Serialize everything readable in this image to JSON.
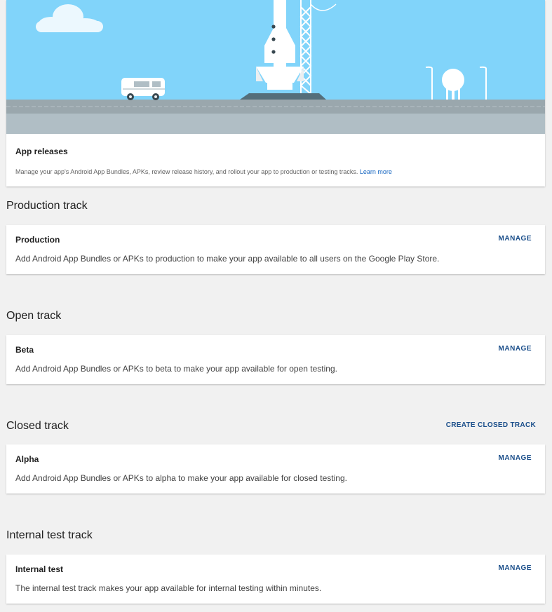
{
  "hero": {
    "title": "App releases",
    "description": "Manage your app's Android App Bundles, APKs, review release history, and rollout your app to production or testing tracks.",
    "link": "Learn more",
    "colors": {
      "sky": "#81d4fa",
      "ground": "#b0bec5"
    }
  },
  "sections": [
    {
      "title": "Production track",
      "action": "",
      "card": {
        "name": "Production",
        "description": "Add Android App Bundles or APKs to production to make your app available to all users on the Google Play Store.",
        "button": "MANAGE"
      }
    },
    {
      "title": "Open track",
      "action": "",
      "card": {
        "name": "Beta",
        "description": "Add Android App Bundles or APKs to beta to make your app available for open testing.",
        "button": "MANAGE"
      }
    },
    {
      "title": "Closed track",
      "action": "CREATE CLOSED TRACK",
      "card": {
        "name": "Alpha",
        "description": "Add Android App Bundles or APKs to alpha to make your app available for closed testing.",
        "button": "MANAGE"
      }
    },
    {
      "title": "Internal test track",
      "action": "",
      "card": {
        "name": "Internal test",
        "description": "The internal test track makes your app available for internal testing within minutes.",
        "button": "MANAGE"
      }
    }
  ],
  "accent_color": "#1a4e8a"
}
